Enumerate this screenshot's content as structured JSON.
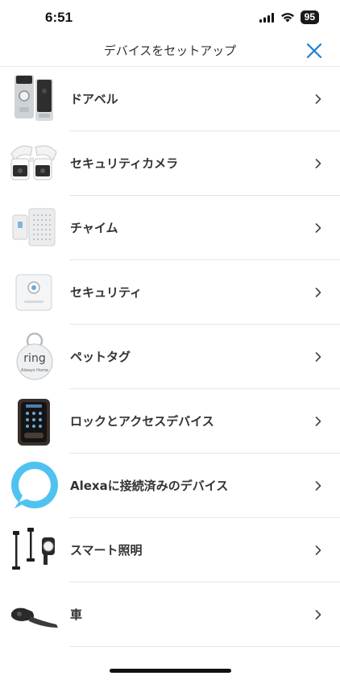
{
  "status_bar": {
    "time": "6:51",
    "battery": "95"
  },
  "header": {
    "title": "デバイスをセットアップ",
    "close_icon": "close-icon",
    "accent_color": "#1f7ecb"
  },
  "devices": [
    {
      "label": "ドアベル",
      "icon": "doorbell-icon"
    },
    {
      "label": "セキュリティカメラ",
      "icon": "security-camera-icon"
    },
    {
      "label": "チャイム",
      "icon": "chime-icon"
    },
    {
      "label": "セキュリティ",
      "icon": "security-keypad-icon"
    },
    {
      "label": "ペットタグ",
      "icon": "pet-tag-icon"
    },
    {
      "label": "ロックとアクセスデバイス",
      "icon": "smart-lock-icon"
    },
    {
      "label": "Alexaに接続済みのデバイス",
      "icon": "alexa-icon"
    },
    {
      "label": "スマート照明",
      "icon": "smart-lighting-icon"
    },
    {
      "label": "車",
      "icon": "car-cam-icon"
    }
  ],
  "pet_tag_text": "ring",
  "pet_tag_subtext": "Always Home"
}
